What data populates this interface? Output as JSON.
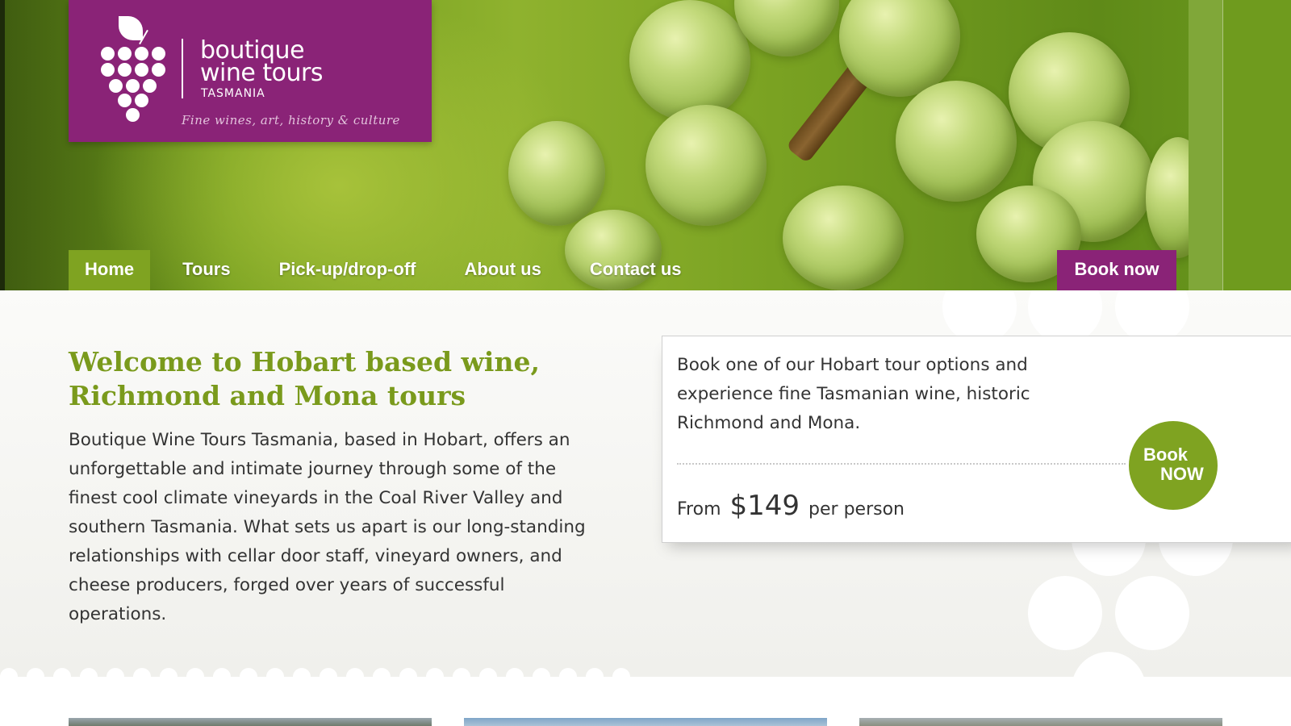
{
  "brand": {
    "name_line1": "boutique",
    "name_line2": "wine tours",
    "region": "TASMANIA",
    "tagline": "Fine wines, art, history & culture",
    "colors": {
      "purple": "#8a2377",
      "green": "#7fa321",
      "title_green": "#7a9a1c"
    }
  },
  "nav": {
    "items": [
      {
        "label": "Home",
        "active": true
      },
      {
        "label": "Tours",
        "active": false
      },
      {
        "label": "Pick-up/drop-off",
        "active": false
      },
      {
        "label": "About us",
        "active": false
      },
      {
        "label": "Contact us",
        "active": false
      }
    ],
    "book_now": "Book now"
  },
  "welcome": {
    "title": "Welcome to Hobart based wine, Richmond and Mona tours",
    "body": "Boutique Wine Tours Tasmania, based in Hobart, offers an unforgettable and intimate journey through some of the finest cool climate vineyards in the Coal River Valley and southern Tasmania. What sets us apart is our long-standing relationships with cellar door staff, vineyard owners, and cheese producers, forged over years of successful operations."
  },
  "booking": {
    "text": "Book one of our Hobart tour options and experience fine Tasmanian wine, historic Richmond and Mona.",
    "from_label": "From",
    "price": "$149",
    "per_label": "per person",
    "button_line1": "Book",
    "button_line2": "NOW"
  },
  "icons": {
    "logo": "grape-cluster-icon"
  }
}
